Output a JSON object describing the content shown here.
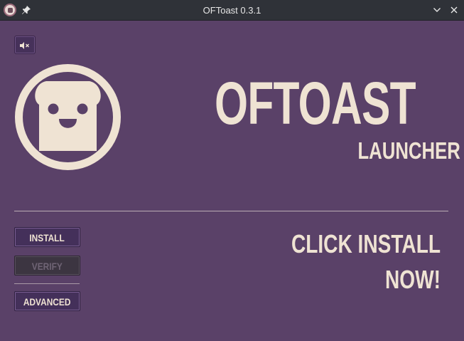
{
  "window": {
    "title": "OFToast 0.3.1",
    "icons": {
      "app": "toast-app-icon",
      "pin": "pin-icon",
      "minimize": "chevron-down-icon",
      "close": "close-icon"
    }
  },
  "audio": {
    "icon": "speaker-muted-icon",
    "glyph": "🔇"
  },
  "header": {
    "title": "OFTOAST",
    "subtitle": "LAUNCHER",
    "logo": "toast-face-logo"
  },
  "actions": {
    "install_label": "INSTALL",
    "verify_label": "VERIFY",
    "advanced_label": "ADVANCED"
  },
  "status": {
    "message": "CLICK INSTALL NOW!"
  },
  "colors": {
    "background": "#5a4168",
    "accent_cream": "#efe3d3",
    "button": "#44305a",
    "button_disabled": "#3c3541",
    "titlebar": "#2f3238"
  }
}
